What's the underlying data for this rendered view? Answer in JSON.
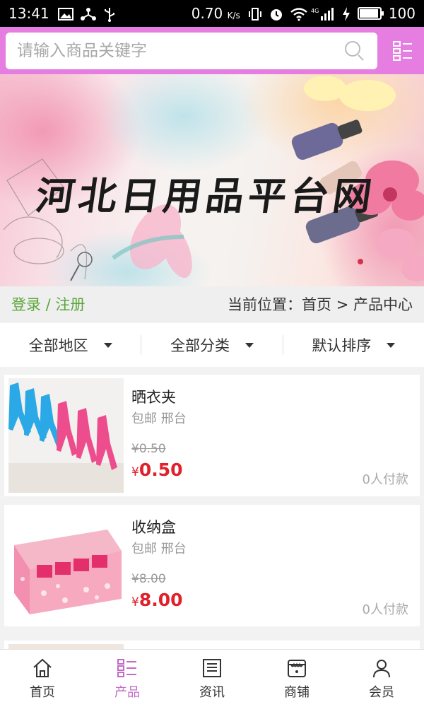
{
  "status_bar": {
    "time": "13:41",
    "net_speed": "0.70",
    "net_unit": "K/s",
    "network_type": "4G",
    "battery": "100",
    "battery_level": 1.0
  },
  "search": {
    "placeholder": "请输入商品关键字"
  },
  "banner": {
    "title": "河北日用品平台网"
  },
  "info_bar": {
    "login_label": "登录 / 注册",
    "breadcrumb": "当前位置：首页 > 产品中心"
  },
  "filters": [
    {
      "label": "全部地区"
    },
    {
      "label": "全部分类"
    },
    {
      "label": "默认排序"
    }
  ],
  "products": [
    {
      "name": "晒衣夹",
      "tags": "包邮 邢台",
      "old_price": "¥0.50",
      "currency": "¥",
      "price": "0.50",
      "paid": "0人付款"
    },
    {
      "name": "收纳盒",
      "tags": "包邮 邢台",
      "old_price": "¥8.00",
      "currency": "¥",
      "price": "8.00",
      "paid": "0人付款"
    }
  ],
  "bottom_nav": [
    {
      "label": "首页",
      "icon": "home-icon"
    },
    {
      "label": "产品",
      "icon": "list-icon",
      "active": true
    },
    {
      "label": "资讯",
      "icon": "news-icon"
    },
    {
      "label": "商铺",
      "icon": "shop-icon"
    },
    {
      "label": "会员",
      "icon": "user-icon"
    }
  ],
  "colors": {
    "accent": "#e67ee1",
    "nav_active": "#c26ac6",
    "price": "#e0202a",
    "login": "#5aa63a"
  }
}
